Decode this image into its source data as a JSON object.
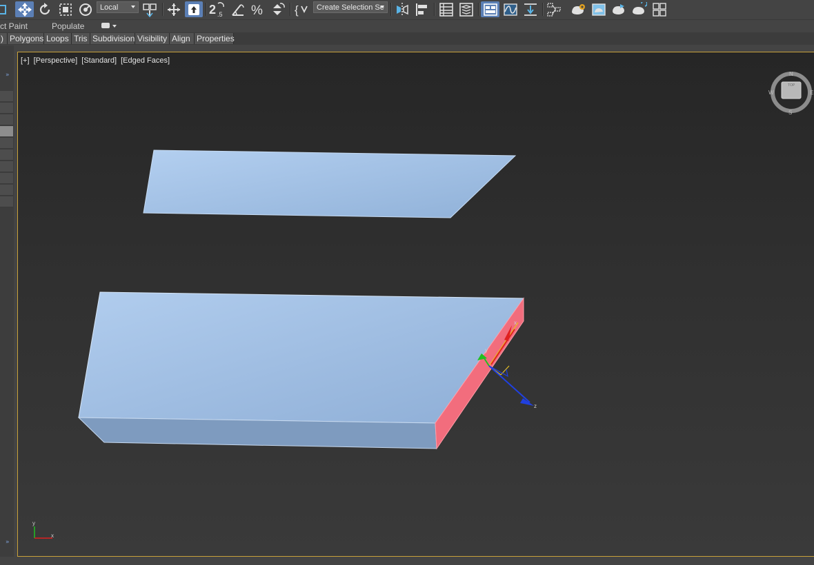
{
  "toolbar": {
    "coord_system": "Local",
    "named_selection": "Create Selection Se",
    "snap_label": "2.5",
    "icons": [
      "move-icon",
      "rotate-icon",
      "scale-icon",
      "select-place-icon",
      "use-pivot-icon",
      "select-manipulate-icon",
      "keyboard-shortcut-override-icon",
      "snap-toggle-icon",
      "angle-snap-icon",
      "percent-snap-icon",
      "spinner-snap-icon",
      "edit-named-selection-icon",
      "mirror-icon",
      "align-icon",
      "scene-explorer-icon",
      "layer-explorer-icon",
      "ribbon-toggle-icon",
      "curve-editor-icon",
      "schematic-view-icon",
      "material-editor-icon",
      "render-setup-icon",
      "rendered-frame-window-icon",
      "render-production-icon",
      "render-iterative-icon",
      "grid-toggle-icon"
    ]
  },
  "ribbon": {
    "row2_items": [
      "ct Paint",
      "Populate"
    ],
    "tabs": [
      ")",
      "Polygons",
      "Loops",
      "Tris",
      "Subdivision",
      "Visibility",
      "Align",
      "Properties"
    ]
  },
  "viewport": {
    "labels": [
      "[+]",
      "[Perspective]",
      "[Standard]",
      "[Edged Faces]"
    ],
    "viewcube": {
      "top_face": "TOP",
      "north": "N",
      "south": "S",
      "west": "W",
      "east": "E"
    },
    "gizmo": {
      "x": "x",
      "y": "y",
      "z": "z"
    },
    "axis_tripod": {
      "x": "x",
      "y": "y"
    },
    "colors": {
      "object_face": "#a9c6ea",
      "object_side": "#7f9cbd",
      "selected_face": "#f26d7d",
      "gizmo_x": "#e02020",
      "gizmo_y": "#20c020",
      "gizmo_z": "#2040e0",
      "viewport_border": "#c9a23a"
    }
  }
}
